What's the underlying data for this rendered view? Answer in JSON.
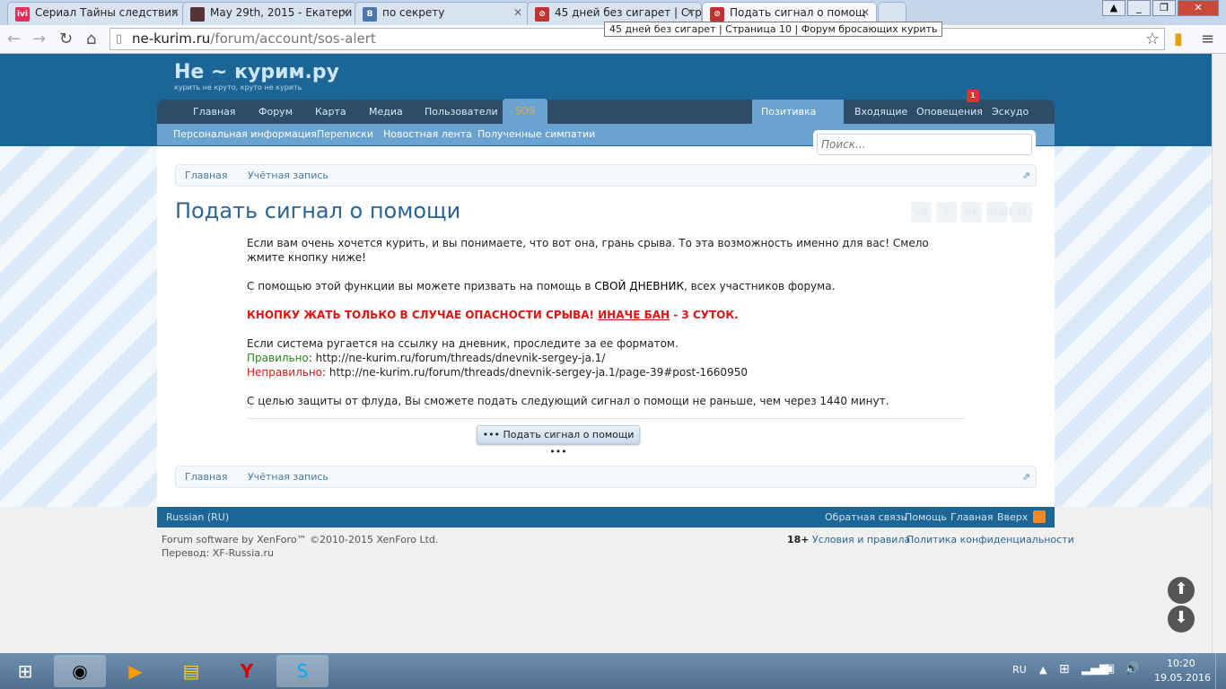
{
  "browser": {
    "tabs": [
      {
        "title": "Сериал Тайны следствия",
        "favicon": "ivi",
        "color": "#e0305a"
      },
      {
        "title": "May 29th, 2015 - Екатери",
        "favicon": "avatar",
        "color": "#553333"
      },
      {
        "title": "по секрету",
        "favicon": "B",
        "color": "#4a76a8"
      },
      {
        "title": "45 дней без сигарет | Стр",
        "favicon": "nekurim",
        "color": "#c03030"
      },
      {
        "title": "Подать сигнал о помощ",
        "favicon": "nekurim",
        "color": "#c03030"
      }
    ],
    "url_domain": "ne-kurim.ru",
    "url_path": "/forum/account/sos-alert",
    "tooltip": "45 дней без сигарет | Страница 10 | Форум бросающих курить"
  },
  "site": {
    "logo_title": "Не ~ курим.ру",
    "logo_slogan": "курить не круто, круто не курить",
    "nav": [
      "Главная",
      "Форум",
      "Карта",
      "Медиа",
      "Пользователи",
      "SOS"
    ],
    "nav_right": [
      "Позитивка",
      "Входящие",
      "Оповещения",
      "Эскудо"
    ],
    "notifications_badge": "1",
    "subnav": [
      "Персональная информация",
      "Переписки",
      "Новостная лента",
      "Полученные симпатии"
    ],
    "search_placeholder": "Поиск...",
    "breadcrumb": [
      "Главная",
      "Учётная запись"
    ],
    "page_title": "Подать сигнал о помощи",
    "share": [
      "vk",
      "f",
      "ok",
      "mail",
      "G"
    ],
    "body": {
      "p1": "Если вам очень хочется курить, и вы понимаете, что вот она, грань срыва. То эта возможность именно для вас! Смело жмите кнопку ниже!",
      "p2a": "С помощью этой функции вы можете призвать на помощь в ",
      "p2b": "СВОЙ ДНЕВНИК",
      "p2c": ", всех участников форума.",
      "warn_a": "КНОПКУ ЖАТЬ ТОЛЬКО В СЛУЧАЕ ОПАСНОСТИ СРЫВА! ",
      "warn_b": "ИНАЧЕ БАН",
      "warn_c": " - 3 СУТОК.",
      "p4": "Если система ругается на ссылку на дневник, проследите за ее форматом.",
      "right_label": "Правильно",
      "right_url": ": http://ne-kurim.ru/forum/threads/dnevnik-sergey-ja.1/",
      "wrong_label": "Неправильно",
      "wrong_url": ": http://ne-kurim.ru/forum/threads/dnevnik-sergey-ja.1/page-39#post-1660950",
      "p5": "С целью защиты от флуда, Вы сможете подать следующий сигнал о помощи не раньше, чем через 1440 минут."
    },
    "sos_button": "••• Подать сигнал о помощи •••",
    "footer": {
      "language": "Russian (RU)",
      "links": [
        "Обратная связь",
        "Помощь",
        "Главная",
        "Вверх"
      ],
      "copyright": "Forum software by XenForo™ ©2010-2015 XenForo Ltd.",
      "translation": "Перевод: XF-Russia.ru",
      "age": "18+",
      "terms": "Условия и правила",
      "privacy": "Политика конфиденциальности"
    }
  },
  "taskbar": {
    "lang": "RU",
    "time": "10:20",
    "date": "19.05.2016"
  }
}
